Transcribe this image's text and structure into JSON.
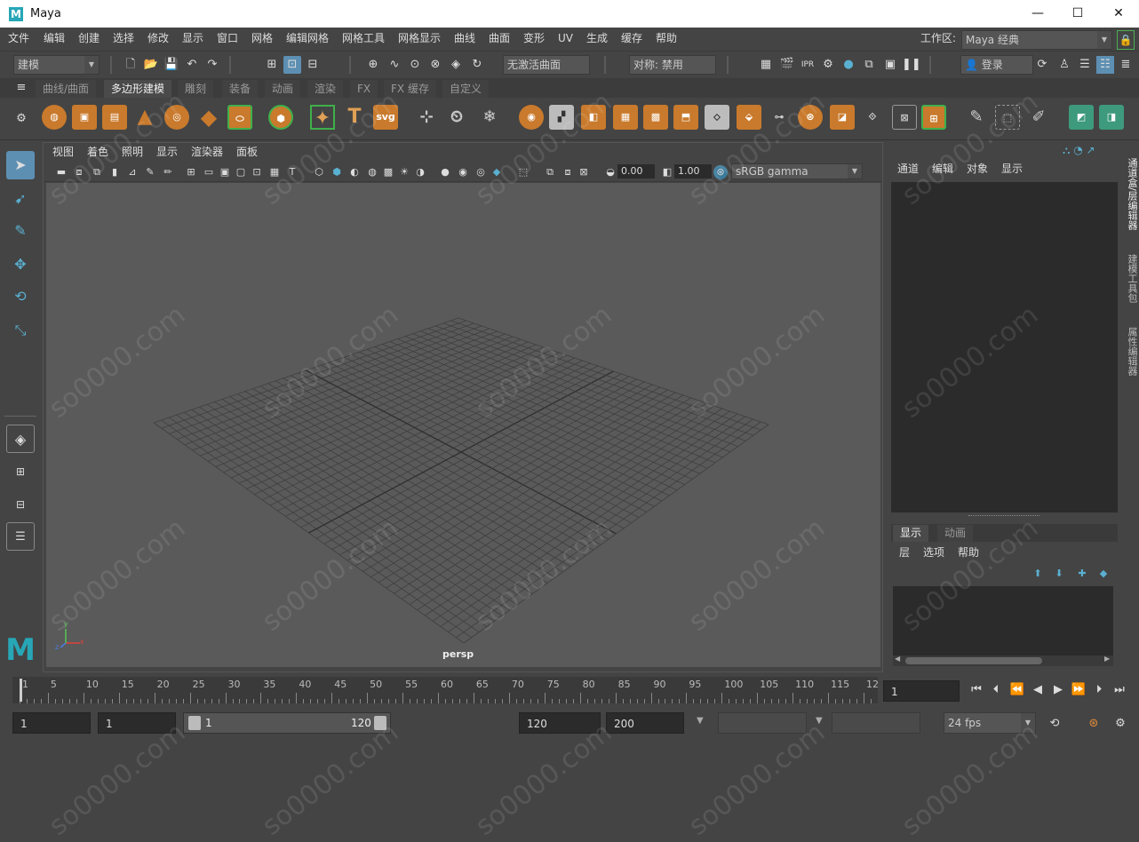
{
  "window": {
    "title": "Maya",
    "logo": "M",
    "minimize": "—",
    "maximize": "☐",
    "close": "✕"
  },
  "menubar": {
    "items": [
      "文件",
      "编辑",
      "创建",
      "选择",
      "修改",
      "显示",
      "窗口",
      "网格",
      "编辑网格",
      "网格工具",
      "网格显示",
      "曲线",
      "曲面",
      "变形",
      "UV",
      "生成",
      "缓存",
      "帮助"
    ],
    "workspace_label": "工作区:",
    "workspace_value": "Maya 经典"
  },
  "statusline": {
    "mode": "建模",
    "no_live_surface": "无激活曲面",
    "symmetry": "对称: 禁用",
    "login": "登录"
  },
  "shelf": {
    "tabs": [
      "曲线/曲面",
      "多边形建模",
      "雕刻",
      "装备",
      "动画",
      "渲染",
      "FX",
      "FX 缓存",
      "自定义"
    ],
    "active_tab": "多边形建模",
    "svg_label": "svg",
    "text_label": "T"
  },
  "viewport": {
    "menu": [
      "视图",
      "着色",
      "照明",
      "显示",
      "渲染器",
      "面板"
    ],
    "exposure": "0.00",
    "gamma": "1.00",
    "colorspace": "sRGB gamma",
    "camera_label": "persp",
    "axis_labels": {
      "x": "x",
      "y": "y",
      "z": "z"
    }
  },
  "channel_box": {
    "menu": [
      "通道",
      "编辑",
      "对象",
      "显示"
    ]
  },
  "layer_editor": {
    "tabs": [
      "显示",
      "动画"
    ],
    "menu": [
      "层",
      "选项",
      "帮助"
    ]
  },
  "side_tabs": [
    "通道盒/层编辑器",
    "建模工具包",
    "属性编辑器"
  ],
  "timeline": {
    "ticks": [
      "1",
      "5",
      "10",
      "15",
      "20",
      "25",
      "30",
      "35",
      "40",
      "45",
      "50",
      "55",
      "60",
      "65",
      "70",
      "75",
      "80",
      "85",
      "90",
      "95",
      "100",
      "105",
      "110",
      "115",
      "12"
    ],
    "current_frame": "1"
  },
  "range": {
    "start": "1",
    "playback_start": "1",
    "slider_start": "1",
    "slider_end": "120",
    "playback_end": "120",
    "end": "200",
    "fps": "24 fps"
  },
  "watermark": "so0000.com",
  "colors": {
    "accent": "#5d8fb3",
    "shelf_icon": "#c97a2c",
    "viewport_bg": "#5a5a5a"
  }
}
